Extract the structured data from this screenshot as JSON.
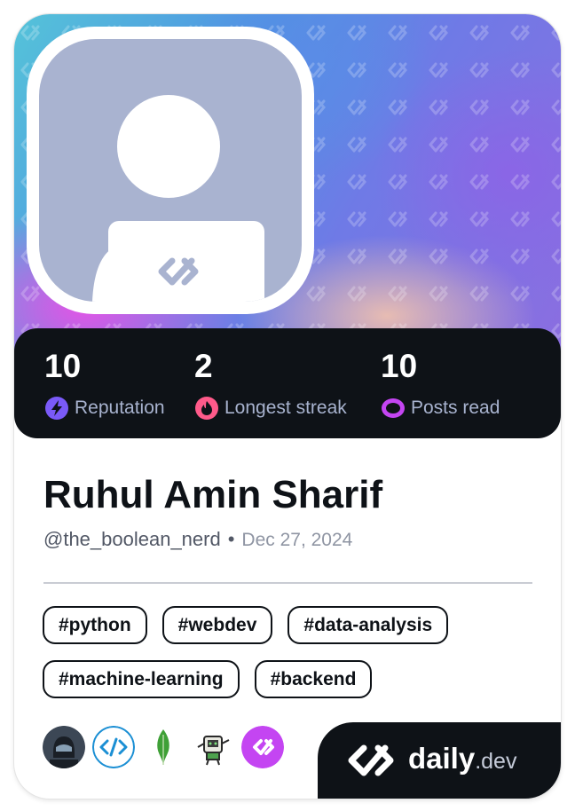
{
  "profile": {
    "name": "Ruhul Amin Sharif",
    "handle": "@the_boolean_nerd",
    "separator": "•",
    "joined": "Dec 27, 2024"
  },
  "stats": [
    {
      "value": "10",
      "label": "Reputation",
      "icon": "bolt-icon",
      "color": "#7a5af8"
    },
    {
      "value": "2",
      "label": "Longest streak",
      "icon": "flame-icon",
      "color": "#ff5a8a"
    },
    {
      "value": "10",
      "label": "Posts read",
      "icon": "eye-icon",
      "color": "#c445f2"
    }
  ],
  "tags": [
    [
      "#python",
      "#webdev",
      "#data-analysis"
    ],
    [
      "#machine-learning",
      "#backend"
    ]
  ],
  "stack": [
    "helmet-avatar-icon",
    "code-icon",
    "mongodb-leaf-icon",
    "robot-icon",
    "daily-dev-icon"
  ],
  "brand": {
    "daily": "daily",
    "dev": ".dev"
  },
  "colors": {
    "dark": "#0e1217",
    "muted": "#a8b3cf",
    "accent": "#c445f2"
  }
}
